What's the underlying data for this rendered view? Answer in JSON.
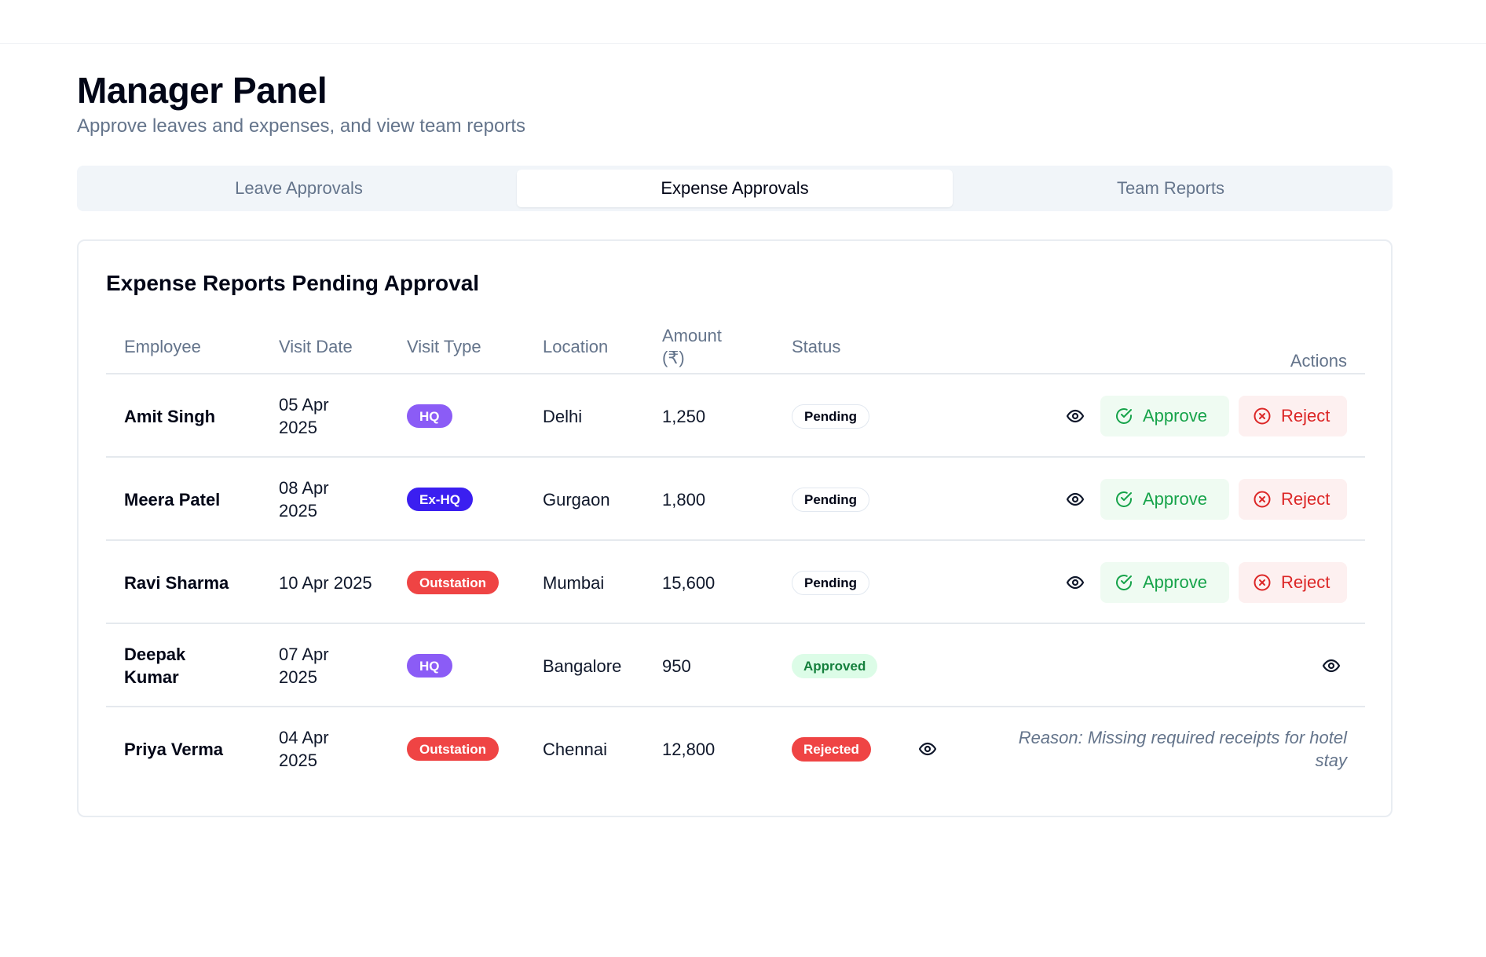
{
  "page": {
    "title": "Manager Panel",
    "subtitle": "Approve leaves and expenses, and view team reports"
  },
  "tabs": [
    {
      "label": "Leave Approvals",
      "active": false
    },
    {
      "label": "Expense Approvals",
      "active": true
    },
    {
      "label": "Team Reports",
      "active": false
    }
  ],
  "card": {
    "title": "Expense Reports Pending Approval"
  },
  "table": {
    "headers": {
      "employee": "Employee",
      "visit_date": "Visit Date",
      "visit_type": "Visit Type",
      "location": "Location",
      "amount": "Amount (₹)",
      "status": "Status",
      "actions": "Actions"
    },
    "approve_label": "Approve",
    "reject_label": "Reject",
    "rows": [
      {
        "employee": "Amit Singh",
        "visit_date": "05 Apr 2025",
        "visit_type": "HQ",
        "location": "Delhi",
        "amount": "1,250",
        "status": "Pending"
      },
      {
        "employee": "Meera Patel",
        "visit_date": "08 Apr 2025",
        "visit_type": "Ex-HQ",
        "location": "Gurgaon",
        "amount": "1,800",
        "status": "Pending"
      },
      {
        "employee": "Ravi Sharma",
        "visit_date": "10 Apr 2025",
        "visit_type": "Outstation",
        "location": "Mumbai",
        "amount": "15,600",
        "status": "Pending"
      },
      {
        "employee": "Deepak Kumar",
        "visit_date": "07 Apr 2025",
        "visit_type": "HQ",
        "location": "Bangalore",
        "amount": "950",
        "status": "Approved"
      },
      {
        "employee": "Priya Verma",
        "visit_date": "04 Apr 2025",
        "visit_type": "Outstation",
        "location": "Chennai",
        "amount": "12,800",
        "status": "Rejected",
        "reason": "Reason: Missing required receipts for hotel stay"
      }
    ]
  },
  "colors": {
    "hq": "#8b5cf6",
    "ex_hq": "#3b1ff0",
    "outstation": "#ef4444",
    "approve": "#16a34a",
    "reject": "#dc2626"
  },
  "icons": {
    "view": "eye-icon",
    "approve": "check-circle-icon",
    "reject": "x-circle-icon"
  }
}
